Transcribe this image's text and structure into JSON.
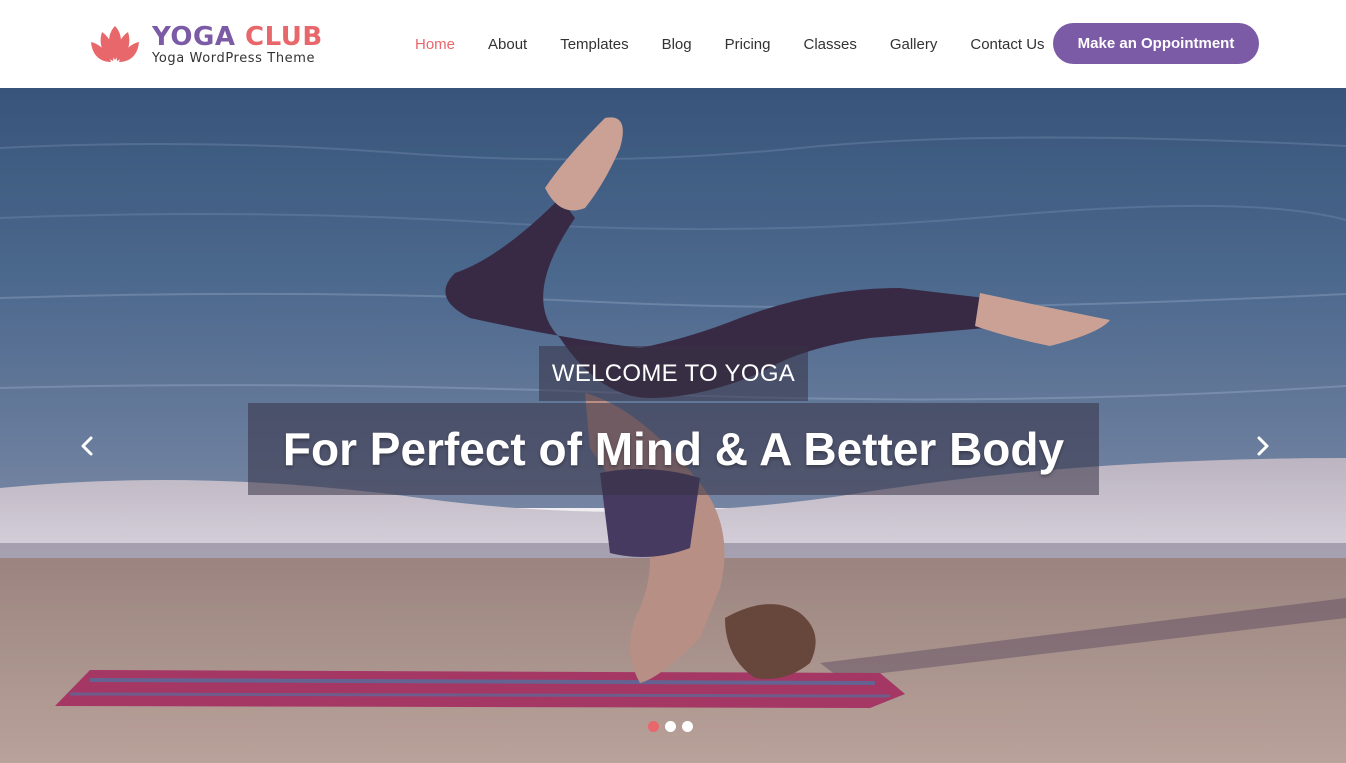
{
  "brand": {
    "title_part1": "YOGA",
    "title_part2": "CLUB",
    "tagline": "Yoga WordPress Theme",
    "primary_color": "#7b5aa6",
    "accent_color": "#e8676b",
    "logo_icon": "lotus-icon"
  },
  "nav": {
    "items": [
      {
        "label": "Home",
        "active": true
      },
      {
        "label": "About",
        "active": false
      },
      {
        "label": "Templates",
        "active": false
      },
      {
        "label": "Blog",
        "active": false
      },
      {
        "label": "Pricing",
        "active": false
      },
      {
        "label": "Classes",
        "active": false
      },
      {
        "label": "Gallery",
        "active": false
      },
      {
        "label": "Contact Us",
        "active": false
      }
    ],
    "cta_label": "Make an Oppointment"
  },
  "hero": {
    "kicker": "WELCOME TO YOGA",
    "headline": "For Perfect of Mind & A Better Body",
    "prev_icon": "chevron-left-icon",
    "next_icon": "chevron-right-icon",
    "slides_count": 3,
    "active_slide": 1
  }
}
